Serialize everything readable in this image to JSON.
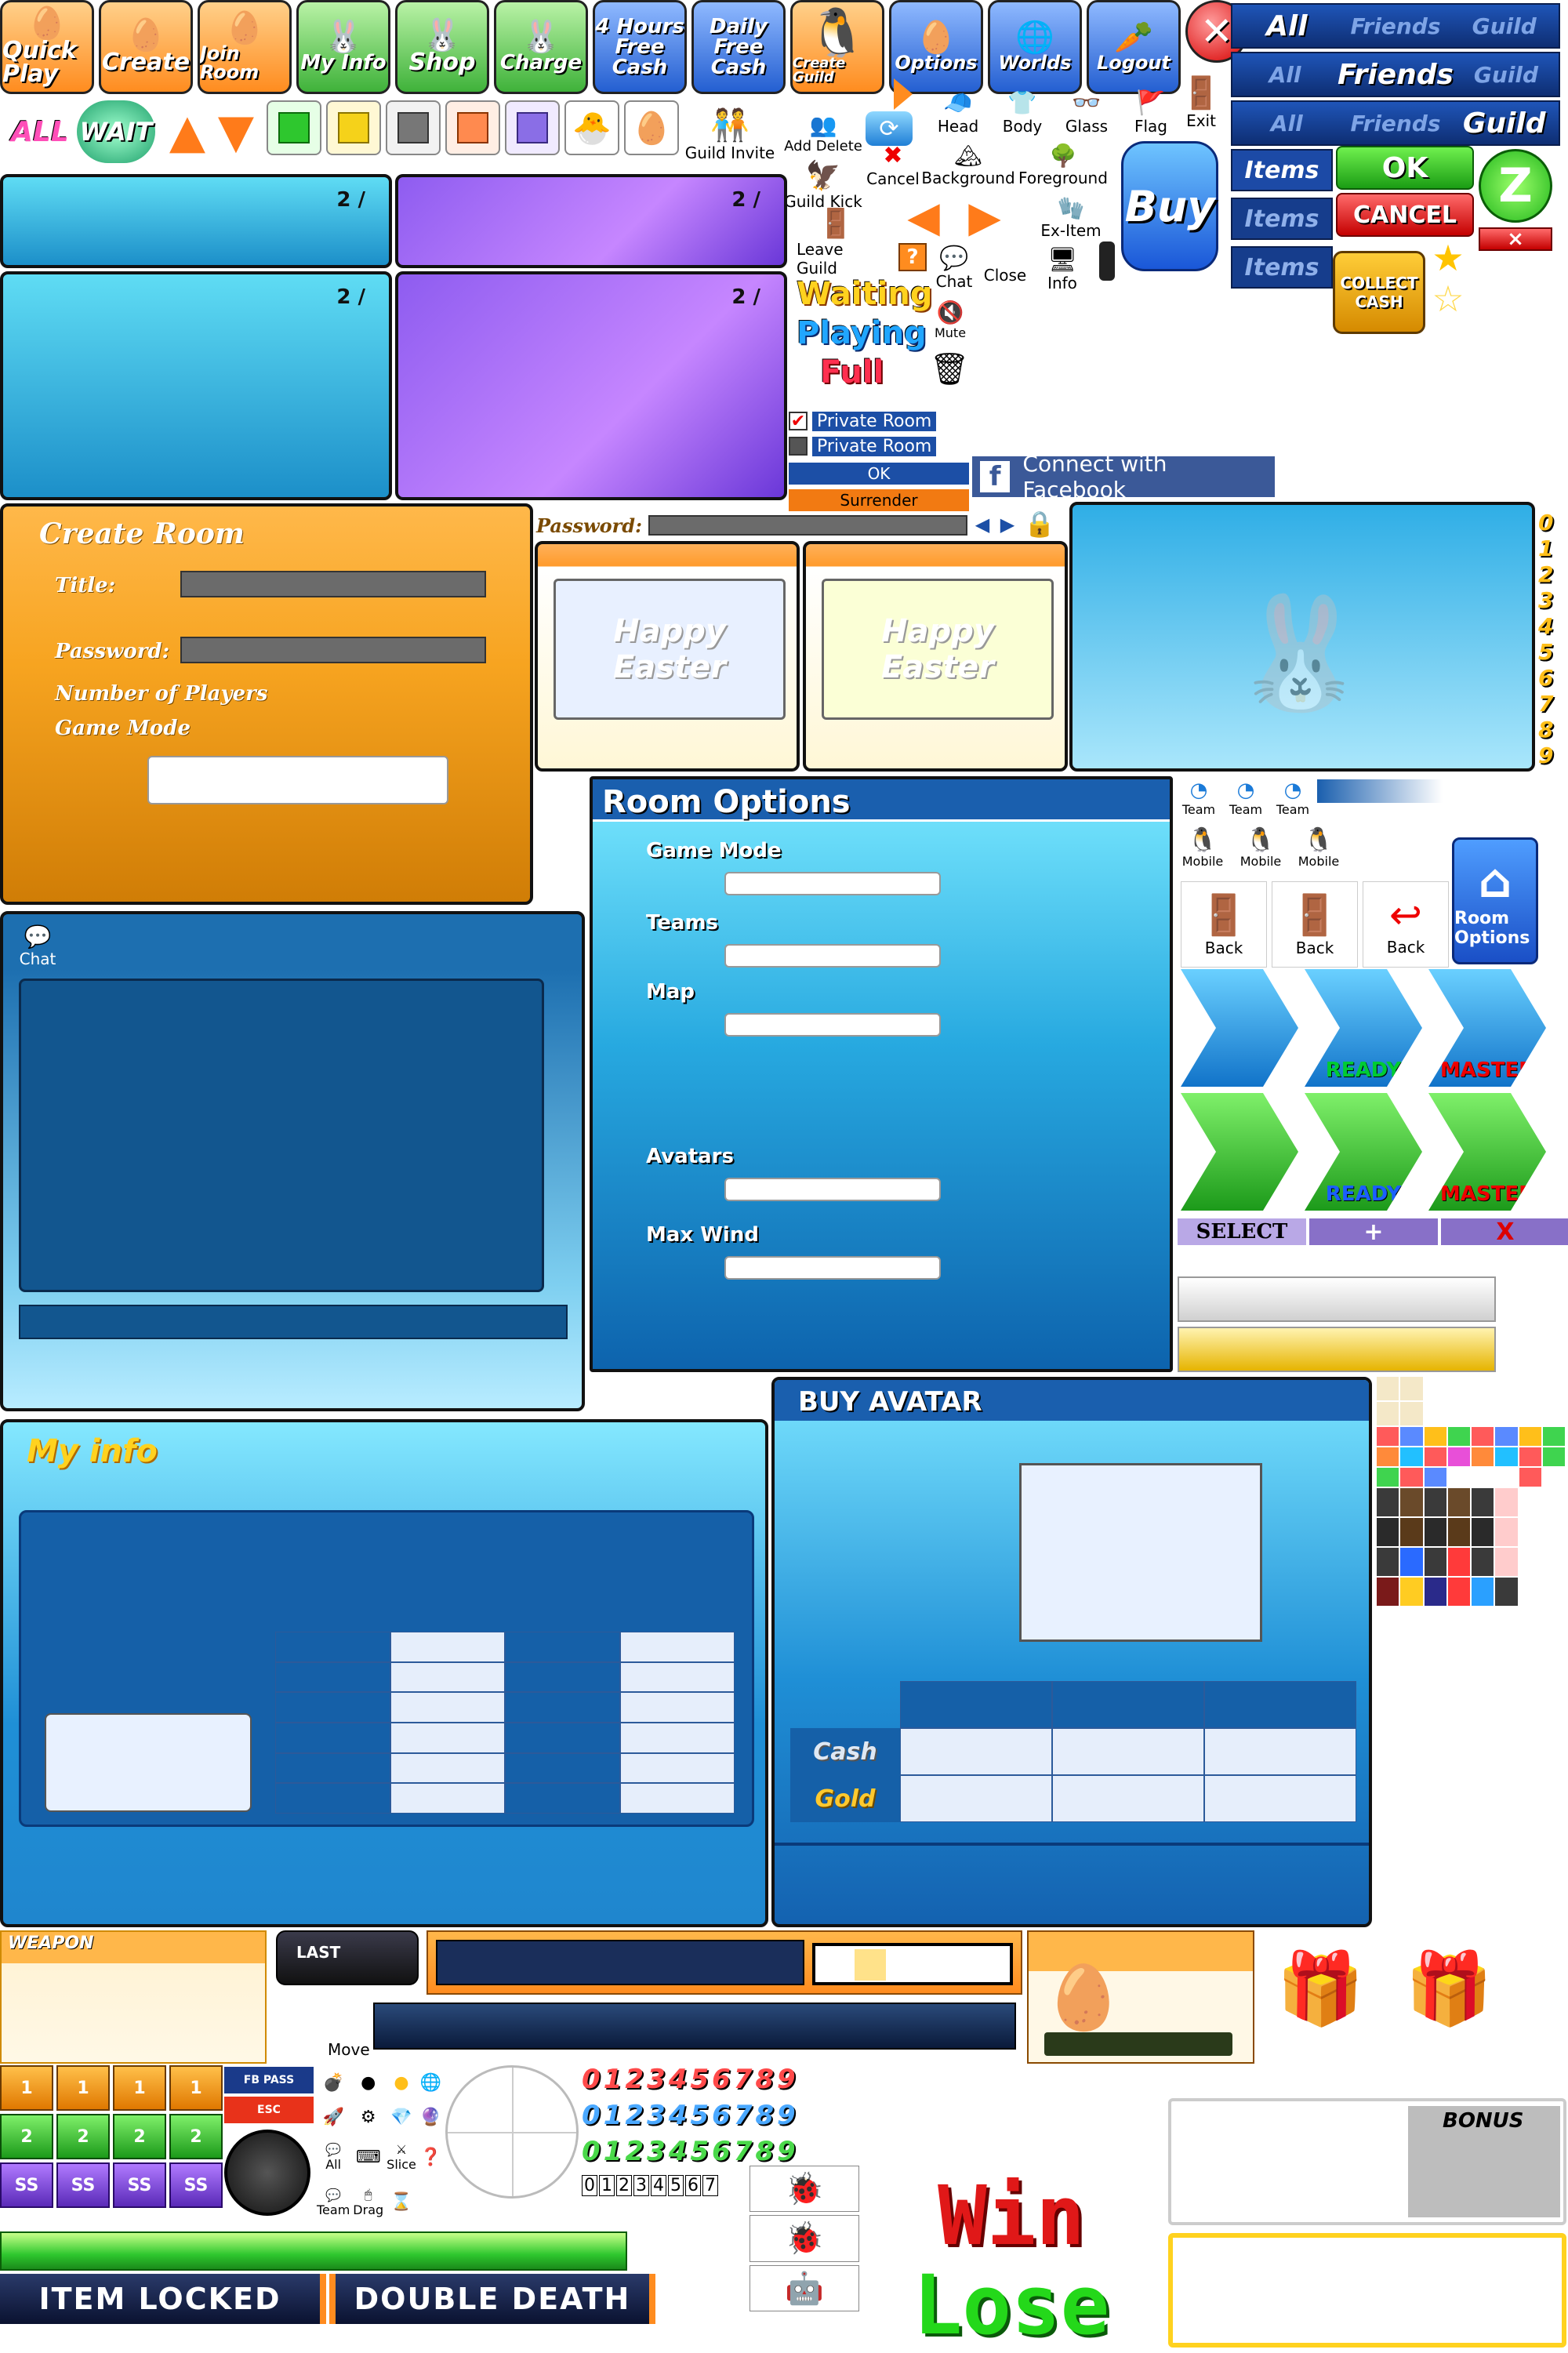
{
  "top_buttons": [
    {
      "label": "Quick Play",
      "icon": "heart-egg-icon"
    },
    {
      "label": "Create",
      "icon": "egg-icon"
    },
    {
      "label": "Join Room",
      "icon": "egg-icon"
    },
    {
      "label": "My Info",
      "icon": "bunny-icon"
    },
    {
      "label": "Shop",
      "icon": "bunny-icon"
    },
    {
      "label": "Charge",
      "icon": "bunny-icon"
    },
    {
      "label": "4 Hours Free Cash"
    },
    {
      "label": "Daily Free Cash"
    },
    {
      "label": "Create Guild",
      "icon": "guild-mascot-icon"
    },
    {
      "label": "Options",
      "icon": "egg-icon"
    },
    {
      "label": "Worlds",
      "icon": "globe-icon"
    },
    {
      "label": "Logout",
      "icon": "carrot-icon"
    },
    {
      "label": "Exit"
    }
  ],
  "tabs": [
    {
      "items": [
        "All",
        "Friends",
        "Guild"
      ],
      "active": 0
    },
    {
      "items": [
        "All",
        "Friends",
        "Guild"
      ],
      "active": 1
    },
    {
      "items": [
        "All",
        "Friends",
        "Guild"
      ],
      "active": 2
    }
  ],
  "filter": {
    "all": "ALL",
    "wait": "WAIT"
  },
  "guild_actions": {
    "invite": "Guild Invite",
    "add_delete": "Add Delete",
    "kick": "Guild Kick",
    "leave": "Leave Guild",
    "cancel": "Cancel",
    "background": "Background",
    "foreground": "Foreground",
    "ex_item": "Ex-Item",
    "chat": "Chat",
    "close": "Close",
    "info": "Info",
    "mute": "Mute"
  },
  "equip": {
    "head": "Head",
    "body": "Body",
    "glass": "Glass",
    "flag": "Flag",
    "exit": "Exit"
  },
  "items_label": "Items",
  "ok": "OK",
  "cancel": "CANCEL",
  "close_mark": "×",
  "buy": "Buy",
  "collect_cash": "COLLECT CASH",
  "status": {
    "waiting": "Waiting",
    "playing": "Playing",
    "full": "Full"
  },
  "private_room": "Private Room",
  "ok_small": "OK",
  "surrender": "Surrender",
  "facebook": "Connect with Facebook",
  "password_bar": "Password:",
  "create_room": {
    "title": "Create Room",
    "title_label": "Title:",
    "password_label": "Password:",
    "players_label": "Number of Players",
    "mode_label": "Game Mode"
  },
  "room_preview_text": "Happy Easter",
  "digits": [
    "0",
    "1",
    "2",
    "3",
    "4",
    "5",
    "6",
    "7",
    "8",
    "9"
  ],
  "room_options": {
    "title": "Room Options",
    "game_mode": "Game Mode",
    "teams": "Teams",
    "map": "Map",
    "avatars": "Avatars",
    "max_wind": "Max Wind"
  },
  "team_label": "Team",
  "mobile_label": "Mobile",
  "back_label": "Back",
  "room_options_button": "Room Options",
  "ready": "READY",
  "master": "MASTER",
  "select_bar": [
    "SELECT",
    "+",
    "X"
  ],
  "chat_label": "Chat",
  "my_info": "My info",
  "buy_avatar": {
    "title": "BUY AVATAR",
    "cash": "Cash",
    "gold": "Gold"
  },
  "weapon": "WEAPON",
  "last": "LAST",
  "move": "Move",
  "fb_pass": "FB PASS",
  "esc": "ESC",
  "controls": {
    "all": "All",
    "team": "Team",
    "slice": "Slice",
    "drag": "Drag"
  },
  "tiles": [
    "1",
    "1",
    "1",
    "1",
    "2",
    "2",
    "2",
    "2",
    "SS",
    "SS",
    "SS",
    "SS"
  ],
  "bonus": "BONUS",
  "win": "Win",
  "lose": "Lose",
  "item_locked": "ITEM LOCKED",
  "double_death": "DOUBLE DEATH"
}
